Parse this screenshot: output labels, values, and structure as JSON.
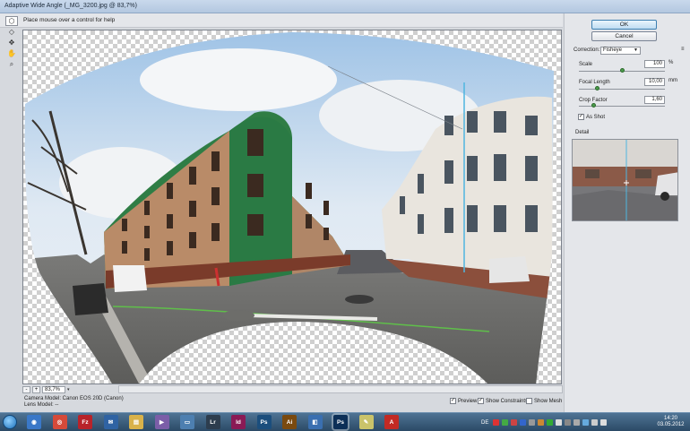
{
  "window": {
    "title": "Adaptive Wide Angle (_MG_3200.jpg @ 83,7%)"
  },
  "hint": "Place mouse over a control for help",
  "tools": [
    {
      "name": "constraint-tool-icon",
      "glyph": "⬡"
    },
    {
      "name": "polygon-constraint-tool-icon",
      "glyph": "◇"
    },
    {
      "name": "move-tool-icon",
      "glyph": "✥"
    },
    {
      "name": "hand-tool-icon",
      "glyph": "✋"
    },
    {
      "name": "zoom-tool-icon",
      "glyph": "⌕"
    }
  ],
  "zoom": {
    "minus": "-",
    "plus": "+",
    "value": "83,7%",
    "arrow": "▾"
  },
  "camera_info": {
    "camera_model": "Camera Model: Canon EOS 20D (Canon)",
    "lens_model": "Lens Model: --"
  },
  "bottom_options": {
    "preview": {
      "label": "Preview",
      "checked": true
    },
    "show_constraints": {
      "label": "Show Constraints",
      "checked": true
    },
    "show_mesh": {
      "label": "Show Mesh",
      "checked": false
    }
  },
  "buttons": {
    "ok": "OK",
    "cancel": "Cancel"
  },
  "panel": {
    "correction_label": "Correction:",
    "correction_value": "Fisheye",
    "settings_icon": "≡",
    "scale": {
      "label": "Scale",
      "value": "100",
      "unit": "%",
      "level": 0.5
    },
    "focal_length": {
      "label": "Focal Length",
      "value": "10,00",
      "unit": "mm",
      "level": 0.2
    },
    "crop_factor": {
      "label": "Crop Factor",
      "value": "1,60",
      "level": 0.15
    },
    "as_shot": {
      "label": "As Shot",
      "checked": true
    },
    "detail_label": "Detail"
  },
  "taskbar": {
    "apps": [
      {
        "name": "browser-icon",
        "glyph": "◉",
        "color": "#3a78c8"
      },
      {
        "name": "chrome-icon",
        "glyph": "◎",
        "color": "#d54a3a"
      },
      {
        "name": "filezilla-icon",
        "glyph": "Fz",
        "color": "#b8232a"
      },
      {
        "name": "thunderbird-icon",
        "glyph": "✉",
        "color": "#2f63a3"
      },
      {
        "name": "explorer-icon",
        "glyph": "▤",
        "color": "#d9b24a"
      },
      {
        "name": "vlc-icon",
        "glyph": "▶",
        "color": "#7b5ea8"
      },
      {
        "name": "folder-icon",
        "glyph": "▭",
        "color": "#4d7fb0"
      },
      {
        "name": "lightroom-icon",
        "glyph": "Lr",
        "color": "#2d3d4e"
      },
      {
        "name": "indesign-icon",
        "glyph": "Id",
        "color": "#8a1a55"
      },
      {
        "name": "photoshop-cs-icon",
        "glyph": "Ps",
        "color": "#1b4e7d"
      },
      {
        "name": "illustrator-icon",
        "glyph": "Ai",
        "color": "#7a4a10"
      },
      {
        "name": "media-icon",
        "glyph": "◧",
        "color": "#3a6fb0"
      },
      {
        "name": "photoshop-icon",
        "glyph": "Ps",
        "color": "#0c2f57"
      },
      {
        "name": "notes-icon",
        "glyph": "✎",
        "color": "#c9c36a"
      },
      {
        "name": "acrobat-icon",
        "glyph": "A",
        "color": "#c22a24"
      }
    ],
    "language": "DE",
    "tray_colors": [
      "#d33",
      "#4a4",
      "#c44",
      "#36c",
      "#999",
      "#c83",
      "#3a3",
      "#ddd",
      "#888",
      "#aaa",
      "#6ad",
      "#ccc",
      "#ddd"
    ],
    "clock_time": "14:20",
    "clock_date": "03.05.2012"
  }
}
